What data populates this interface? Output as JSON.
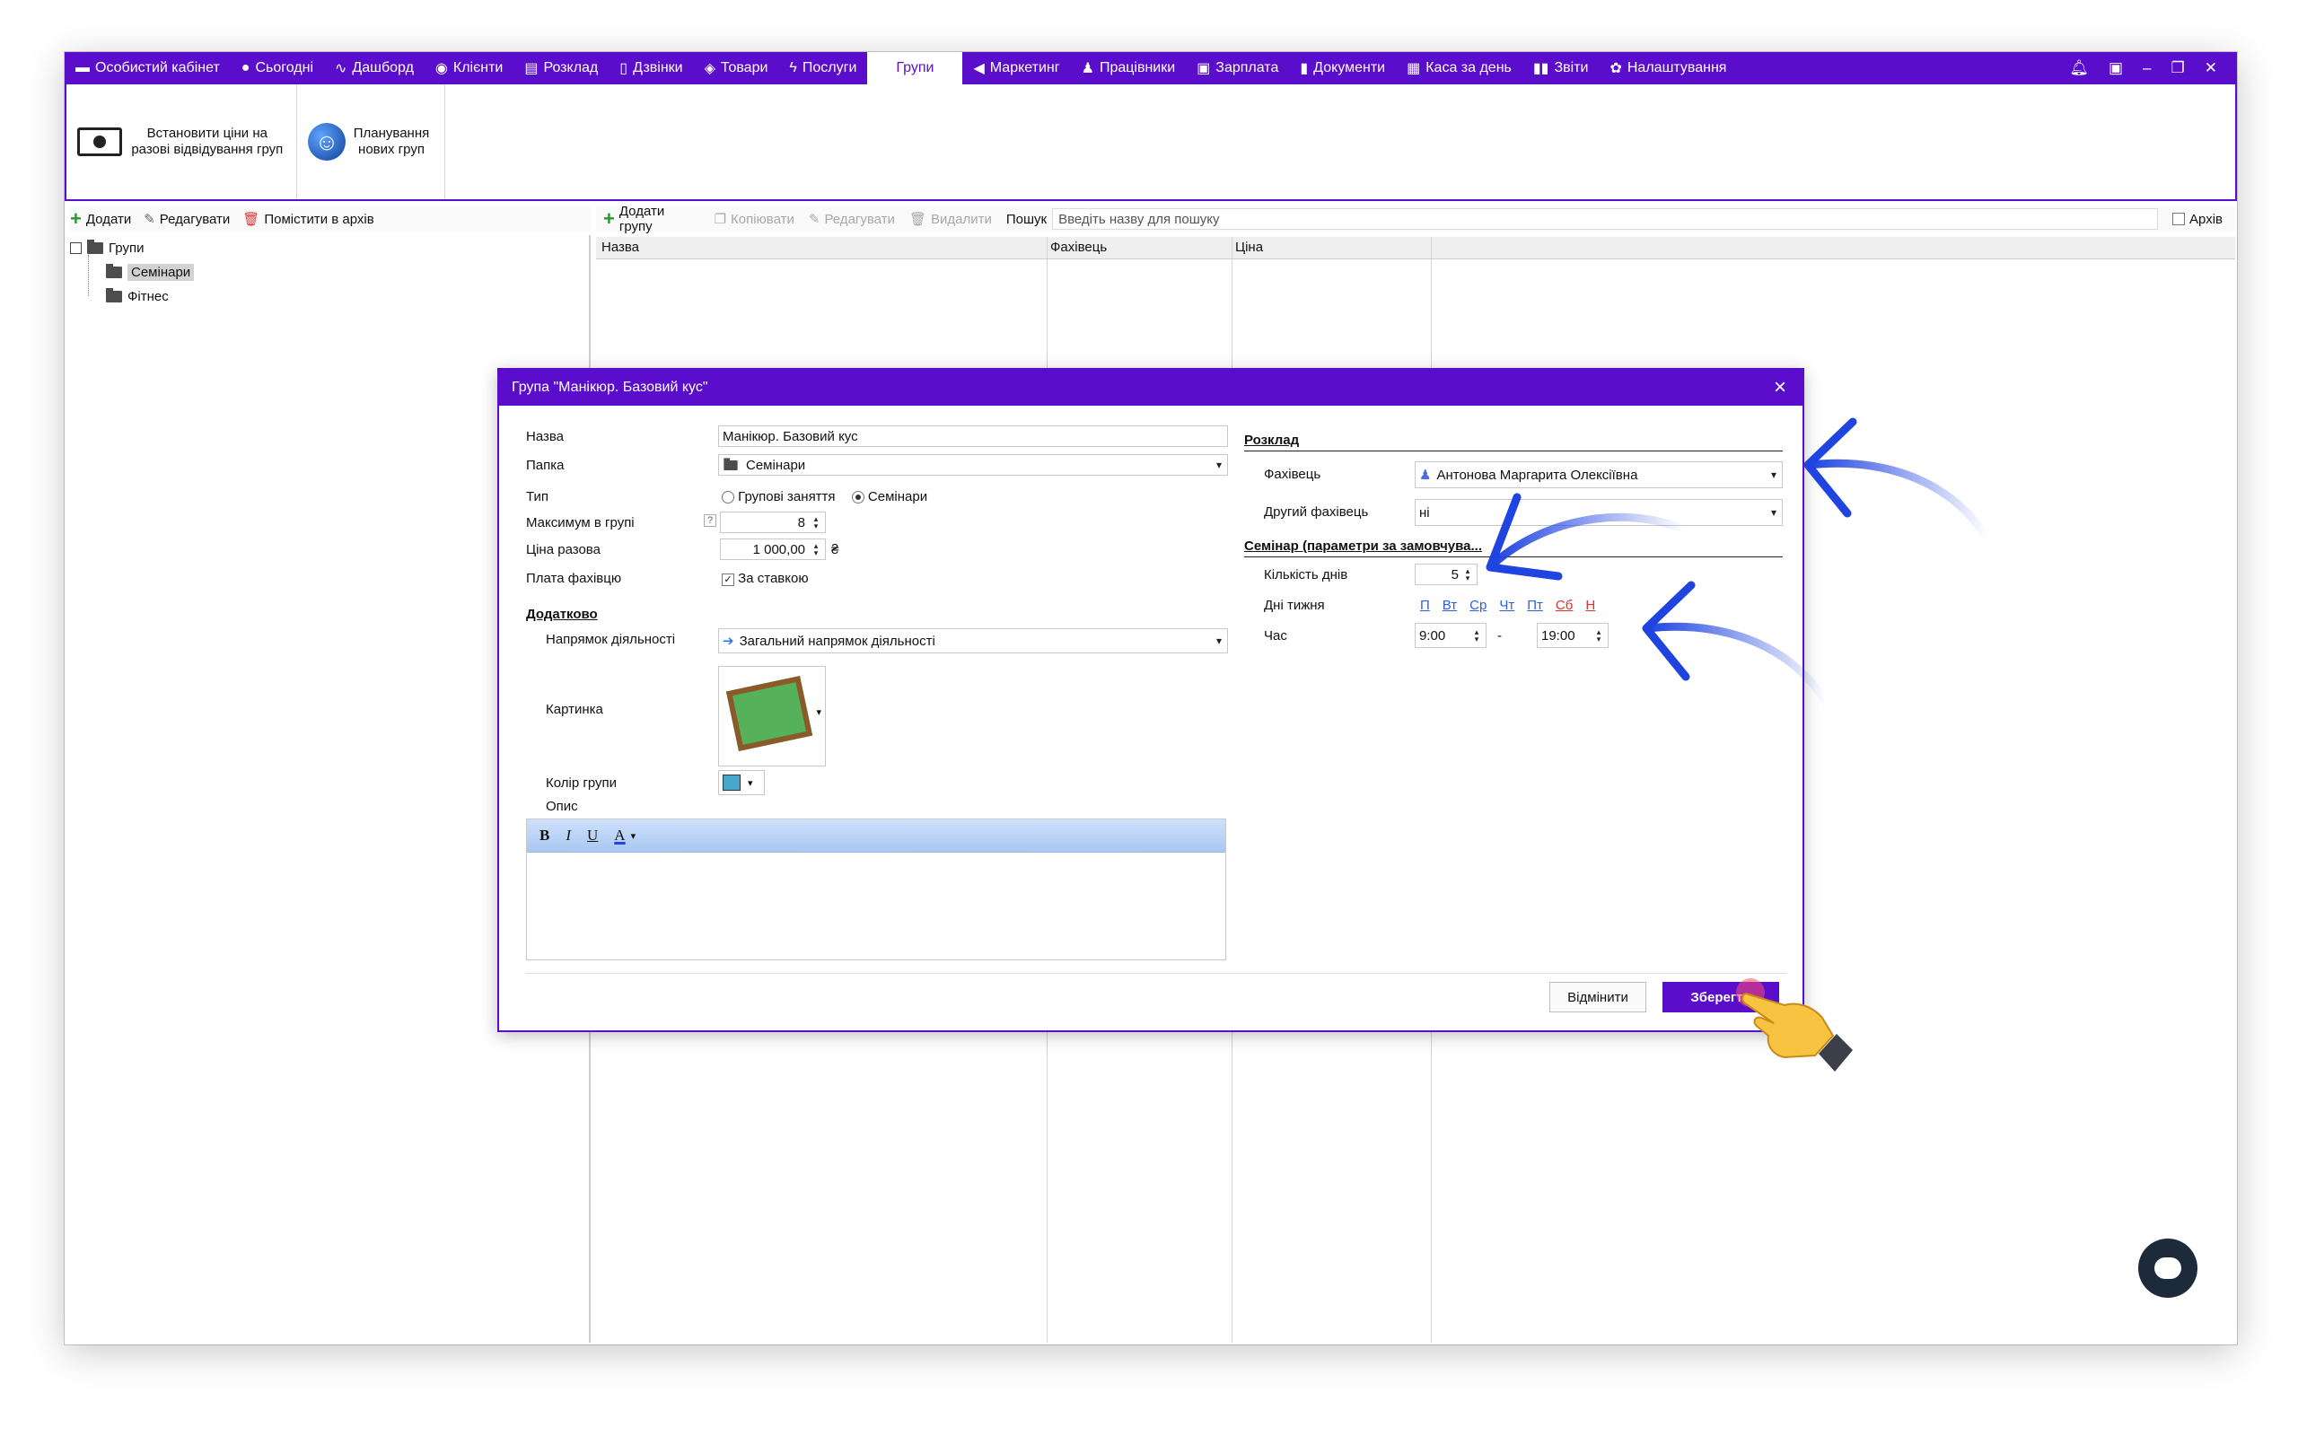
{
  "nav": {
    "tabs": [
      {
        "label": "Особистий кабінет",
        "icon": "cabinet-icon"
      },
      {
        "label": "Сьогодні",
        "icon": "today-icon"
      },
      {
        "label": "Дашборд",
        "icon": "dashboard-icon"
      },
      {
        "label": "Клієнти",
        "icon": "clients-icon"
      },
      {
        "label": "Розклад",
        "icon": "schedule-icon"
      },
      {
        "label": "Дзвінки",
        "icon": "calls-icon"
      },
      {
        "label": "Товари",
        "icon": "goods-icon"
      },
      {
        "label": "Послуги",
        "icon": "services-icon"
      },
      {
        "label": "Групи",
        "icon": "",
        "active": true
      },
      {
        "label": "Маркетинг",
        "icon": "marketing-icon"
      },
      {
        "label": "Працівники",
        "icon": "employees-icon"
      },
      {
        "label": "Зарплата",
        "icon": "salary-icon"
      },
      {
        "label": "Документи",
        "icon": "documents-icon"
      },
      {
        "label": "Каса за день",
        "icon": "cashbox-icon"
      },
      {
        "label": "Звіти",
        "icon": "reports-icon"
      },
      {
        "label": "Налаштування",
        "icon": "settings-icon"
      }
    ]
  },
  "ribbon": {
    "btn1_label": "Встановити ціни на разові відвідування груп",
    "btn2_label": "Планування нових груп"
  },
  "left_toolbar": {
    "add": "Додати",
    "edit": "Редагувати",
    "archive": "Помістити в архів"
  },
  "tree": {
    "root": "Групи",
    "children": [
      "Семінари",
      "Фітнес"
    ],
    "selected": "Семінари"
  },
  "right_toolbar": {
    "add_group": "Додати групу",
    "copy": "Копіювати",
    "edit": "Редагувати",
    "delete": "Видалити",
    "search_label": "Пошук",
    "search_placeholder": "Введіть назву для пошуку",
    "archive": "Архів"
  },
  "grid": {
    "columns": [
      "Назва",
      "Фахівець",
      "Ціна"
    ]
  },
  "dialog": {
    "title": "Група \"Манікюр. Базовий кус\"",
    "labels": {
      "name": "Назва",
      "folder": "Папка",
      "type": "Тип",
      "max": "Максимум в групі",
      "price": "Ціна разова",
      "pay": "Плата фахівцю",
      "extra": "Додатково",
      "direction": "Напрямок діяльності",
      "picture": "Картинка",
      "color": "Колір групи",
      "desc": "Опис"
    },
    "values": {
      "name": "Манікюр. Базовий кус",
      "folder": "Семінари",
      "type_opt1": "Групові заняття",
      "type_opt2": "Семінари",
      "type_selected": "Семінари",
      "max": "8",
      "price": "1 000,00",
      "currency": "₴",
      "pay_check": "За ставкою",
      "direction": "Загальний напрямок діяльності",
      "color_hex": "#4aa6c8",
      "help": "?"
    },
    "schedule": {
      "section": "Розклад",
      "specialist_label": "Фахівець",
      "specialist": "Антонова Маргарита Олексіївна",
      "second_label": "Другий фахівець",
      "second": "ні"
    },
    "seminar": {
      "section": "Семінар (параметри за замовчува...",
      "days_count_label": "Кількість днів",
      "days_count": "5",
      "weekdays_label": "Дні тижня",
      "weekdays": [
        "П",
        "Вт",
        "Ср",
        "Чт",
        "Пт",
        "Сб",
        "Н"
      ],
      "time_label": "Час",
      "time_from": "9:00",
      "dash": "-",
      "time_to": "19:00"
    },
    "editor": {
      "bold": "B",
      "italic": "I",
      "underline": "U",
      "color": "A"
    },
    "buttons": {
      "cancel": "Відмінити",
      "save": "Зберегти"
    }
  },
  "colors": {
    "accent": "#5a0ecc",
    "arrow": "#1f44e0"
  }
}
